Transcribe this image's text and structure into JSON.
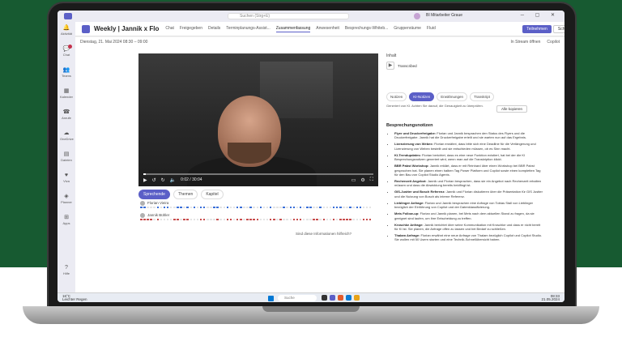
{
  "titlebar": {
    "search_placeholder": "Suchen (Strg+E)",
    "user": "BI Mitarbeiter Graue"
  },
  "rail": [
    {
      "label": "Aktivität",
      "icon": "bell-icon"
    },
    {
      "label": "Chat",
      "icon": "chat-icon"
    },
    {
      "label": "Teams",
      "icon": "teams-icon"
    },
    {
      "label": "Kalender",
      "icon": "calendar-icon"
    },
    {
      "label": "Anrufe",
      "icon": "phone-icon"
    },
    {
      "label": "OneDrive",
      "icon": "cloud-icon"
    },
    {
      "label": "Dateien",
      "icon": "file-icon"
    },
    {
      "label": "Viva",
      "icon": "heart-icon"
    },
    {
      "label": "Planner",
      "icon": "planner-icon"
    },
    {
      "label": "Apps",
      "icon": "apps-icon"
    },
    {
      "label": "Hilfe",
      "icon": "help-icon"
    }
  ],
  "meeting": {
    "title": "Weekly | Jannik x Flo",
    "tabs": [
      "Chat",
      "Freigegeben",
      "Details",
      "Terminplanungs-Assist...",
      "Zusammenfassung",
      "Anwesenheit",
      "Besprechungs-Whiteb...",
      "Gruppenräume",
      "Fluid"
    ],
    "active_tab": "Zusammenfassung",
    "join_label": "Teilnehmen",
    "close_label": "Schließen",
    "date": "Dienstag, 21. Mai 2024 08:30 – 09:00",
    "open_stream": "In Stream öffnen",
    "copilot": "Copilot"
  },
  "video": {
    "time": "0:02 / 30:04",
    "progress": 0.01
  },
  "panel_tabs": [
    {
      "label": "Sprechende",
      "active": true
    },
    {
      "label": "Themen",
      "active": false
    },
    {
      "label": "Kapitel",
      "active": false
    }
  ],
  "speakers": [
    {
      "name": "Florian Vieira"
    },
    {
      "name": "Jannik Bühler"
    }
  ],
  "feedback": "Sind diese Informationen hilfreich?",
  "right": {
    "label": "Inhalt",
    "recording": "Transcribed",
    "tabs": [
      {
        "label": "Notizen",
        "active": false
      },
      {
        "label": "KI-Notizen",
        "active": true
      },
      {
        "label": "Erwähnungen",
        "active": false
      },
      {
        "label": "Transkript",
        "active": false
      }
    ],
    "note": "Generiert von KI. Achten Sie darauf, die Genauigkeit zu überprüfen.",
    "cta": "Alle kopieren",
    "section": "Besprechungsnotizen",
    "notes": [
      {
        "title": "Flyer und Druckerfreigabe:",
        "text": "Florian und Jannik besprachen den Status des Flyers und die Druckerfreigabe. Jannik hat die Druckerfreigabe erteilt und sie warten nun auf das Ergebnis."
      },
      {
        "title": "Lizenzierung von Webex:",
        "text": "Florian erwähnt, dass bitte sich eine Deadline für die Verlängerung und Lizenzierung von Webex bestellt und sie entschieden müssen, ob es Sinn macht."
      },
      {
        "title": "KI-Trendupdates:",
        "text": "Florian berichtet, dass es eine neue Funktion existiert, hat bei der die KI Besprechungsnotizen generiert wird, wenn man auf die Transkription klickt."
      },
      {
        "title": "BBR Pabst Workshop:",
        "text": "Jannik erklärt, dass er mit Reinhard über einen Workshop bei BBR Pabst gesprochen hat. Sie planen einen halben Tag Power Platform und Copilot sowie einen kompletten Tag für den Bau von Copilot Studio Agents."
      },
      {
        "title": "Rechenzeit Angebot:",
        "text": "Jannik und Florian besprachen, dass sie ein Angebot nach Rechenzeit erhalten müssen und dass die Abwicklung bereits beidfingt ist."
      },
      {
        "title": "GIS-Justter und Bosch Referenz:",
        "text": "Jannik und Florian diskutieren über die Präsentation für GIS Justter und die Nutzung von Bosch als interne Referenz."
      },
      {
        "title": "Lieblinger Anfrage:",
        "text": "Florian und Jannik besprachen eine Anfrage von Tobias Stall von Lieblinger bezüglich der Einführung von Copilot und der Datenklassifizierung."
      },
      {
        "title": "Mets Follow-up:",
        "text": "Florian und Jannik planen, bei Mets nach dem aktuellen Stand zu fragen, da sie geeignet sind laufen, um ihre Entscheidung zu treffen."
      },
      {
        "title": "Kroschke Anfrage:",
        "text": "Jannik berichtet über seine Kommunikation mit Kroschke und dass er nicht bereit für KI ist. Sie planen, die Anfrage offen zu lassen und bei Bedarf zu schließen."
      },
      {
        "title": "Thalam Anfrage:",
        "text": "Florian erwähnt eine neue Anfrage von Thalam bezüglich Copilot und Copilot Studio. Sie wollen mit 50 Usern starten und eine Technik-Schnellübersicht haben."
      }
    ]
  },
  "taskbar": {
    "weather_temp": "16°C",
    "weather_text": "Leichter Regen",
    "search": "Suche",
    "time": "08:33",
    "date": "21.05.2024"
  },
  "colors": {
    "accent": "#5b5fc7",
    "background": "#175a31"
  }
}
